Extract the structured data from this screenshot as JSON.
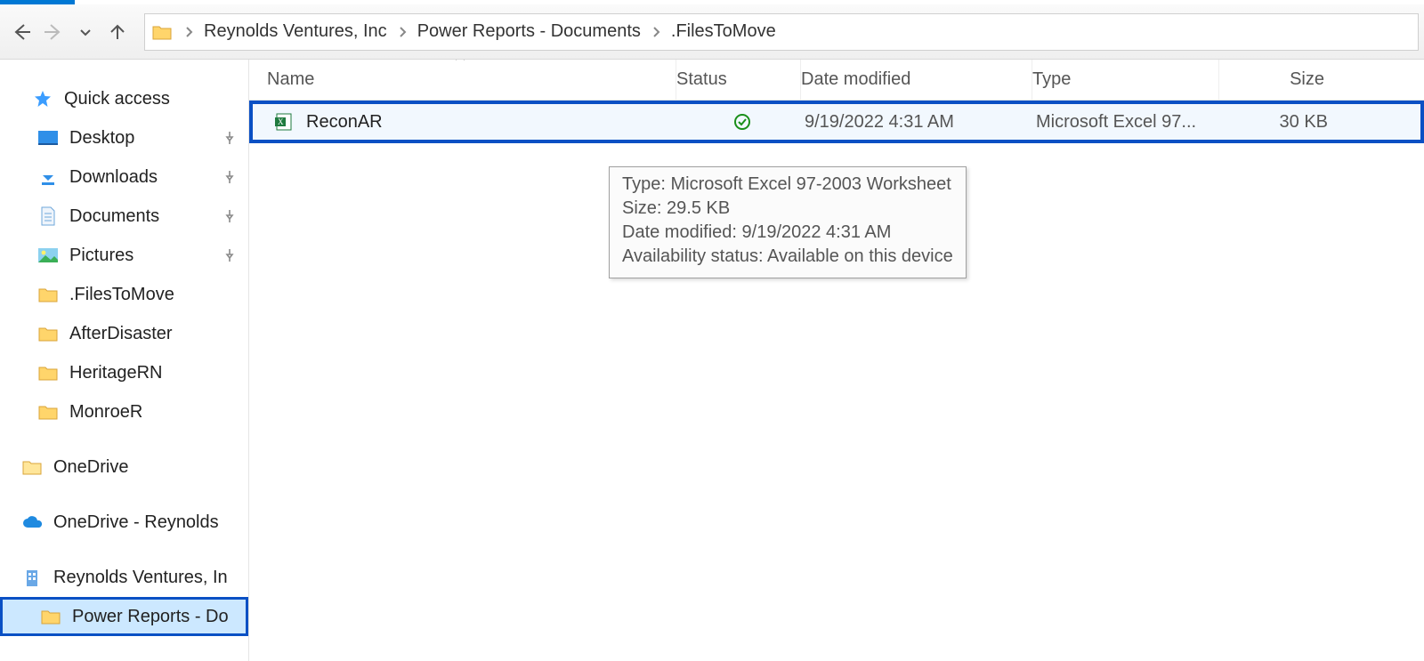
{
  "breadcrumb": {
    "seg1": "Reynolds Ventures, Inc",
    "seg2": "Power Reports - Documents",
    "seg3": ".FilesToMove"
  },
  "columns": {
    "name": "Name",
    "status": "Status",
    "date": "Date modified",
    "type": "Type",
    "size": "Size"
  },
  "file": {
    "name": "ReconAR",
    "date": "9/19/2022 4:31 AM",
    "type": "Microsoft Excel 97...",
    "size": "30 KB"
  },
  "tooltip": {
    "l1": "Type: Microsoft Excel 97-2003 Worksheet",
    "l2": "Size: 29.5 KB",
    "l3": "Date modified: 9/19/2022 4:31 AM",
    "l4": "Availability status: Available on this device"
  },
  "sidebar": {
    "quick_access": "Quick access",
    "desktop": "Desktop",
    "downloads": "Downloads",
    "documents": "Documents",
    "pictures": "Pictures",
    "filestomove": ".FilesToMove",
    "afterdisaster": "AfterDisaster",
    "heritagern": "HeritageRN",
    "monroer": "MonroeR",
    "onedrive": "OneDrive",
    "onedrive_reynolds": "OneDrive - Reynolds",
    "reynolds_ventures": "Reynolds Ventures, In",
    "power_reports": "Power Reports - Do"
  }
}
